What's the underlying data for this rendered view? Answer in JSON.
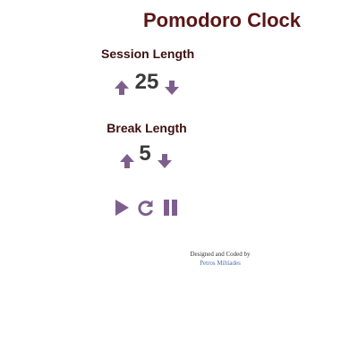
{
  "app": {
    "title": "Pomodoro Clock"
  },
  "session": {
    "label": "Session Length",
    "value": "25",
    "increase_icon": "arrow-up-icon",
    "decrease_icon": "arrow-down-icon"
  },
  "break": {
    "label": "Break Length",
    "value": "5",
    "increase_icon": "arrow-up-icon",
    "decrease_icon": "arrow-down-icon"
  },
  "controls": {
    "play_icon": "play-icon",
    "reset_icon": "refresh-icon",
    "pause_icon": "pause-icon"
  },
  "credit": {
    "line1": "Designed and Coded by",
    "author": "Petros Miltiades"
  },
  "colors": {
    "title": "#5a1616",
    "label": "#3d1010",
    "icon": "#7d5f8e",
    "link": "#4a6ea8"
  }
}
